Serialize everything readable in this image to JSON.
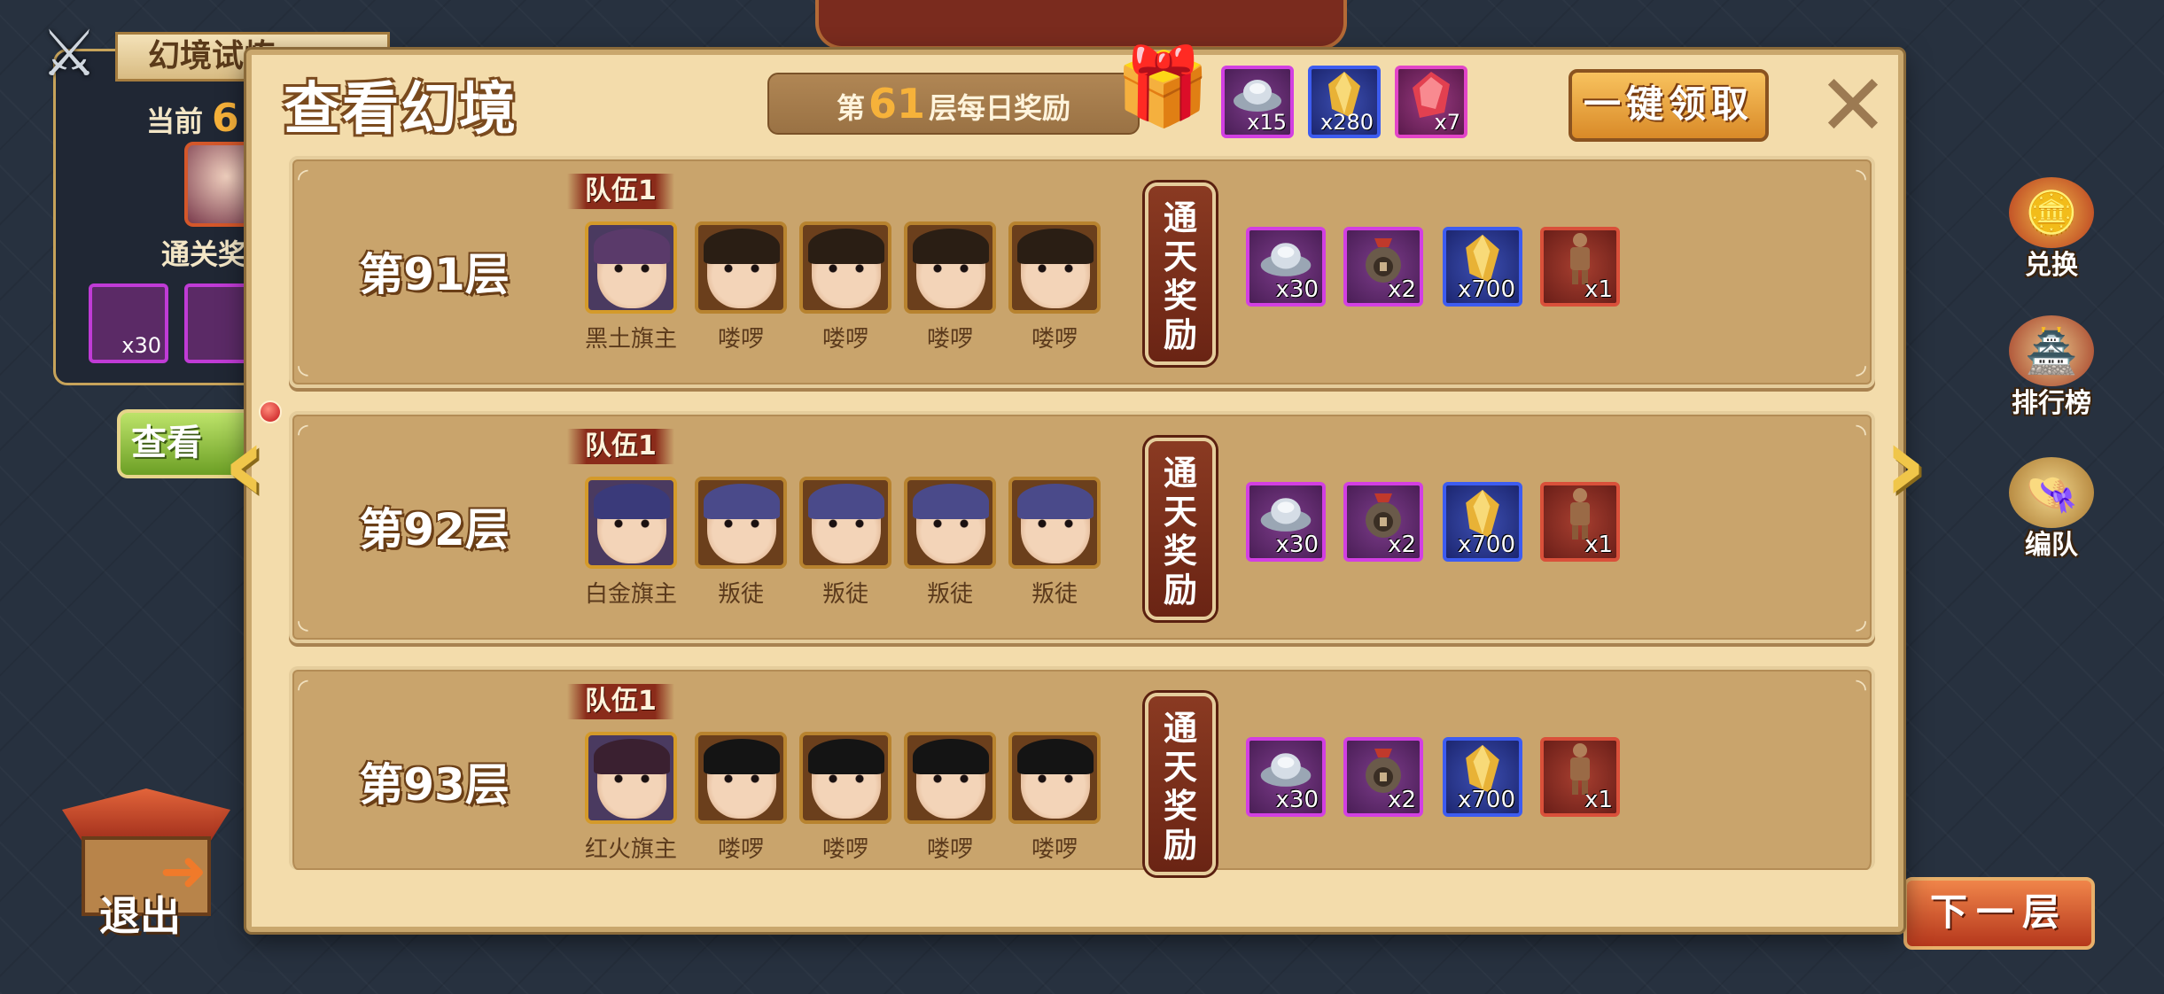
{
  "background": {
    "panel_title": "幻境试炼",
    "current_label": "当前",
    "current_num": "6",
    "reward_label": "通关奖",
    "reward_qty": "x30",
    "view_button": "查看",
    "exit_label": "退出"
  },
  "side_menu": [
    {
      "label": "兑换",
      "icon": "exchange-coin-icon"
    },
    {
      "label": "排行榜",
      "icon": "ranking-pavilion-icon"
    },
    {
      "label": "编队",
      "icon": "formation-hat-icon"
    }
  ],
  "next_button": "下一层",
  "dialog": {
    "title": "查看幻境",
    "daily_prefix": "第",
    "daily_layer": "61",
    "daily_suffix": "层每日奖励",
    "daily_rewards": [
      {
        "icon": "silver-ingot-icon",
        "qty": "x15",
        "rarity": "purple"
      },
      {
        "icon": "gold-crystal-icon",
        "qty": "x280",
        "rarity": "blue"
      },
      {
        "icon": "red-gem-icon",
        "qty": "x7",
        "rarity": "pink"
      }
    ],
    "claim_all_label": "一键领取",
    "close_label": "✕"
  },
  "floors": [
    {
      "name": "第91层",
      "team_label": "队伍1",
      "clear_reward_label": "通天奖励",
      "heroes": [
        {
          "name": "黑土旗主",
          "hair": "#5a3a6a",
          "leader": true
        },
        {
          "name": "喽啰",
          "hair": "#2a1e14",
          "leader": false
        },
        {
          "name": "喽啰",
          "hair": "#2a1e14",
          "leader": false
        },
        {
          "name": "喽啰",
          "hair": "#2a1e14",
          "leader": false
        },
        {
          "name": "喽啰",
          "hair": "#2a1e14",
          "leader": false
        }
      ],
      "rewards": [
        {
          "icon": "silver-ingot-icon",
          "qty": "x30",
          "rarity": "purple"
        },
        {
          "icon": "scroll-pouch-icon",
          "qty": "x2",
          "rarity": "purple"
        },
        {
          "icon": "gold-crystal-icon",
          "qty": "x700",
          "rarity": "blue"
        },
        {
          "icon": "terracotta-warrior-icon",
          "qty": "x1",
          "rarity": "red"
        }
      ]
    },
    {
      "name": "第92层",
      "team_label": "队伍1",
      "clear_reward_label": "通天奖励",
      "heroes": [
        {
          "name": "白金旗主",
          "hair": "#3a3a7a",
          "leader": true
        },
        {
          "name": "叛徒",
          "hair": "#4a4a8a",
          "leader": false
        },
        {
          "name": "叛徒",
          "hair": "#4a4a8a",
          "leader": false
        },
        {
          "name": "叛徒",
          "hair": "#4a4a8a",
          "leader": false
        },
        {
          "name": "叛徒",
          "hair": "#4a4a8a",
          "leader": false
        }
      ],
      "rewards": [
        {
          "icon": "silver-ingot-icon",
          "qty": "x30",
          "rarity": "purple"
        },
        {
          "icon": "scroll-pouch-icon",
          "qty": "x2",
          "rarity": "purple"
        },
        {
          "icon": "gold-crystal-icon",
          "qty": "x700",
          "rarity": "blue"
        },
        {
          "icon": "terracotta-warrior-icon",
          "qty": "x1",
          "rarity": "red"
        }
      ]
    },
    {
      "name": "第93层",
      "team_label": "队伍1",
      "clear_reward_label": "通天奖励",
      "heroes": [
        {
          "name": "红火旗主",
          "hair": "#3a2030",
          "leader": true
        },
        {
          "name": "喽啰",
          "hair": "#141414",
          "leader": false
        },
        {
          "name": "喽啰",
          "hair": "#141414",
          "leader": false
        },
        {
          "name": "喽啰",
          "hair": "#141414",
          "leader": false
        },
        {
          "name": "喽啰",
          "hair": "#141414",
          "leader": false
        }
      ],
      "rewards": [
        {
          "icon": "silver-ingot-icon",
          "qty": "x30",
          "rarity": "purple"
        },
        {
          "icon": "scroll-pouch-icon",
          "qty": "x2",
          "rarity": "purple"
        },
        {
          "icon": "gold-crystal-icon",
          "qty": "x700",
          "rarity": "blue"
        },
        {
          "icon": "terracotta-warrior-icon",
          "qty": "x1",
          "rarity": "red"
        }
      ]
    }
  ]
}
